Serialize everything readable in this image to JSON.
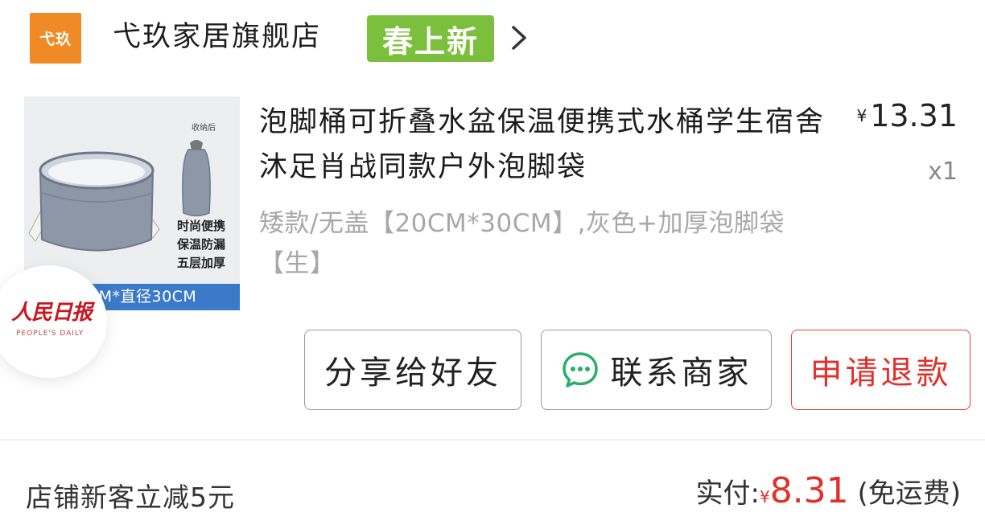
{
  "store": {
    "logo_text": "弋玖",
    "name": "弋玖家居旗舰店",
    "badge": "春上新"
  },
  "product": {
    "image": {
      "note": "收纳后",
      "features": [
        "时尚便携",
        "保温防漏",
        "五层加厚"
      ],
      "caption": "20CM*直径30CM"
    },
    "title": "泡脚桶可折叠水盆保温便携式水桶学生宿舍沐足肖战同款户外泡脚袋",
    "currency": "¥",
    "price": "13.31",
    "quantity": "x1",
    "variant": "矮款/无盖【20CM*30CM】,灰色+加厚泡脚袋【生】"
  },
  "watermark": {
    "logo": "人民日报",
    "subtitle": "PEOPLE'S DAILY"
  },
  "actions": {
    "share": "分享给好友",
    "contact": "联系商家",
    "refund": "申请退款"
  },
  "summary": {
    "promo": "店铺新客立减5元",
    "paid_label": "实付:",
    "currency": "¥",
    "paid_amount": "8.31",
    "shipping": "(免运费)"
  },
  "colors": {
    "store_logo": "#f08a24",
    "badge": "#7cbf3c",
    "accent_red": "#e0302a",
    "caption_blue": "#3b7ac8"
  },
  "icons": [
    "chevron-right-icon",
    "wechat-chat-icon"
  ]
}
